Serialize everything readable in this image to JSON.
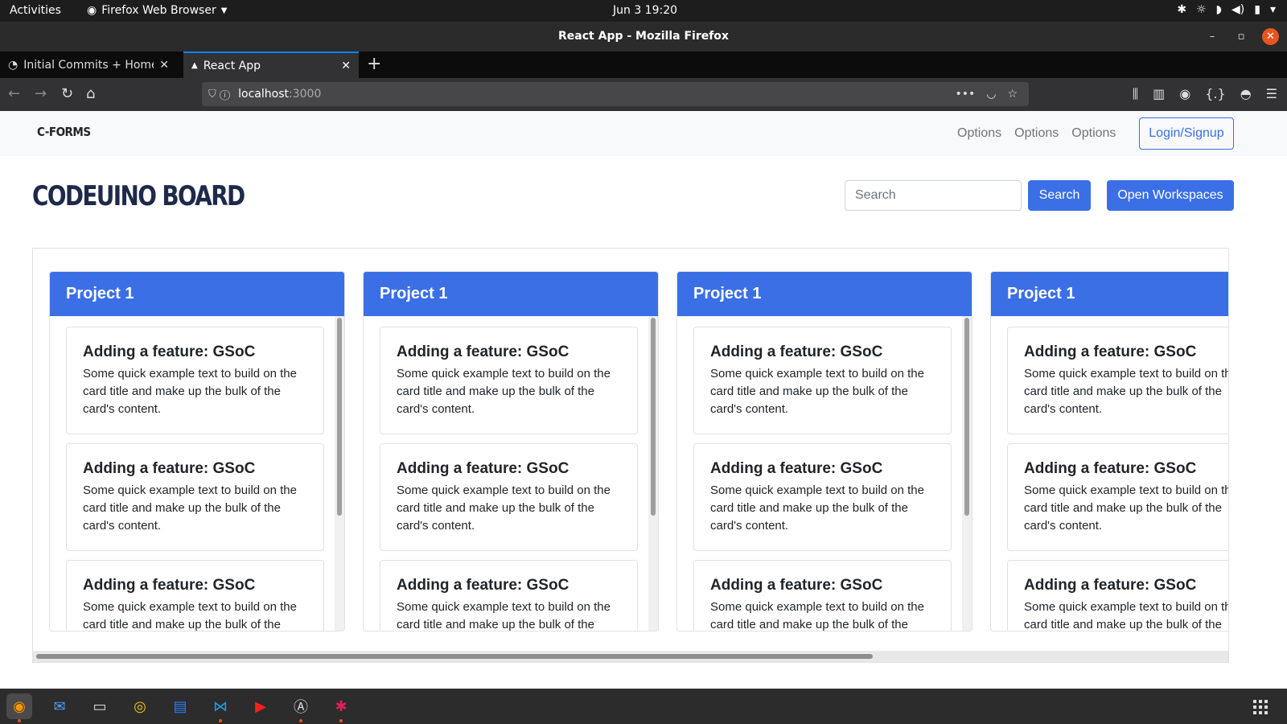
{
  "topbar": {
    "activities": "Activities",
    "app_name": "Firefox Web Browser",
    "clock": "Jun 3  19:20"
  },
  "window": {
    "title": "React App - Mozilla Firefox"
  },
  "tabs": [
    {
      "label": "Initial Commits + Home p"
    },
    {
      "label": "React App"
    }
  ],
  "address": {
    "host": "localhost",
    "port": ":3000"
  },
  "app": {
    "brand": "C-FORMS",
    "nav_options": [
      "Options",
      "Options",
      "Options"
    ],
    "login_label": "Login/Signup",
    "board_title": "CODEUINO BOARD",
    "search_placeholder": "Search",
    "search_button": "Search",
    "workspaces_button": "Open Workspaces",
    "columns": [
      {
        "title": "Project 1",
        "cards": [
          {
            "title": "Adding a feature: GSoC",
            "text": "Some quick example text to build on the card title and make up the bulk of the card's content."
          },
          {
            "title": "Adding a feature: GSoC",
            "text": "Some quick example text to build on the card title and make up the bulk of the card's content."
          },
          {
            "title": "Adding a feature: GSoC",
            "text": "Some quick example text to build on the card title and make up the bulk of the card's content."
          }
        ]
      },
      {
        "title": "Project 1",
        "cards": [
          {
            "title": "Adding a feature: GSoC",
            "text": "Some quick example text to build on the card title and make up the bulk of the card's content."
          },
          {
            "title": "Adding a feature: GSoC",
            "text": "Some quick example text to build on the card title and make up the bulk of the card's content."
          },
          {
            "title": "Adding a feature: GSoC",
            "text": "Some quick example text to build on the card title and make up the bulk of the card's content."
          }
        ]
      },
      {
        "title": "Project 1",
        "cards": [
          {
            "title": "Adding a feature: GSoC",
            "text": "Some quick example text to build on the card title and make up the bulk of the card's content."
          },
          {
            "title": "Adding a feature: GSoC",
            "text": "Some quick example text to build on the card title and make up the bulk of the card's content."
          },
          {
            "title": "Adding a feature: GSoC",
            "text": "Some quick example text to build on the card title and make up the bulk of the card's content."
          }
        ]
      },
      {
        "title": "Project 1",
        "cards": [
          {
            "title": "Adding a feature: GSoC",
            "text": "Some quick example text to build on the card title and make up the bulk of the card's content."
          },
          {
            "title": "Adding a feature: GSoC",
            "text": "Some quick example text to build on the card title and make up the bulk of the card's content."
          },
          {
            "title": "Adding a feature: GSoC",
            "text": "Some quick example text to build on the card title and make up the bulk of the card's content."
          }
        ]
      }
    ]
  },
  "colors": {
    "primary": "#3b6fe6",
    "heading": "#1e2a4a",
    "navbar_bg": "#f8f9fa"
  },
  "taskbar": {
    "apps": [
      "firefox-icon",
      "thunderbird-icon",
      "files-icon",
      "rhythmbox-icon",
      "writer-icon",
      "vscode-icon",
      "youtube-music-icon",
      "software-icon",
      "slack-icon"
    ]
  }
}
